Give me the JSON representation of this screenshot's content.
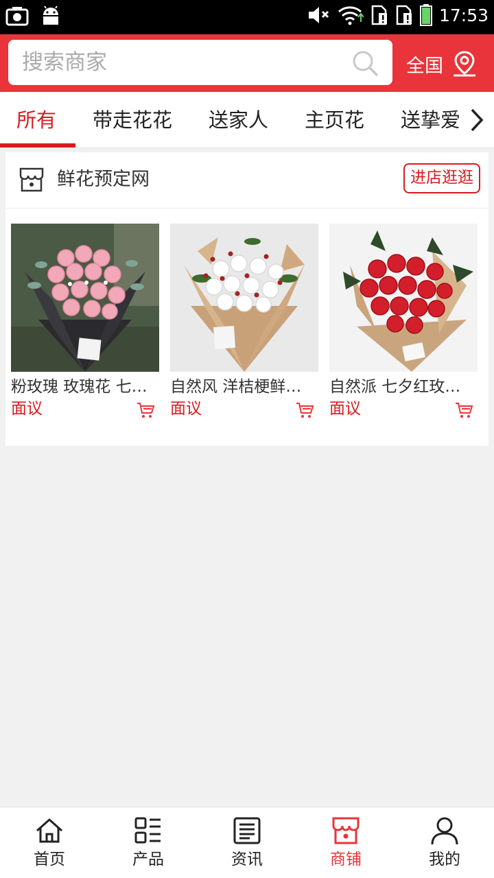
{
  "status_bar": {
    "time": "17:53",
    "left_icons": [
      "screenshot-icon",
      "android-icon"
    ],
    "right_icons": [
      "volume-mute-icon",
      "wifi-icon",
      "sim1-icon",
      "sim2-icon",
      "battery-icon"
    ]
  },
  "header": {
    "search_placeholder": "搜索商家",
    "region_label": "全国",
    "accent_color": "#e8343a"
  },
  "tabs": {
    "items": [
      "所有",
      "带走花花",
      "送家人",
      "主页花",
      "送挚爱"
    ],
    "active_index": 0
  },
  "shop": {
    "name": "鲜花预定网",
    "visit_button": "进店逛逛",
    "products": [
      {
        "title": "粉玫瑰 玫瑰花 七…",
        "price": "面议",
        "image": "pink-rose-bouquet"
      },
      {
        "title": "自然风 洋桔梗鲜…",
        "price": "面议",
        "image": "white-eustoma-bouquet"
      },
      {
        "title": "自然派 七夕红玫…",
        "price": "面议",
        "image": "red-rose-bouquet"
      }
    ]
  },
  "bottom_nav": {
    "items": [
      {
        "label": "首页",
        "icon": "home-icon"
      },
      {
        "label": "产品",
        "icon": "product-grid-icon"
      },
      {
        "label": "资讯",
        "icon": "news-icon"
      },
      {
        "label": "商铺",
        "icon": "store-icon"
      },
      {
        "label": "我的",
        "icon": "user-icon"
      }
    ],
    "active_index": 3
  }
}
